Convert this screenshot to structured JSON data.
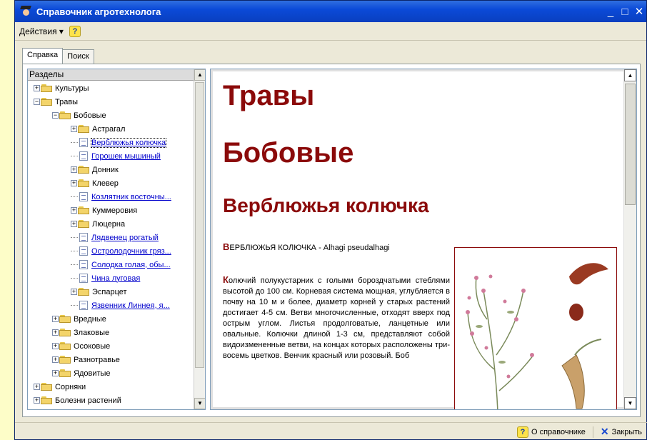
{
  "window": {
    "title": "Справочник агротехнолога",
    "controls": [
      "_",
      "□",
      "✕"
    ]
  },
  "menu": {
    "actions_label": "Действия ▾",
    "help_label": "?"
  },
  "tabs": [
    {
      "label": "Справка"
    },
    {
      "label": "Поиск"
    }
  ],
  "tree": {
    "header": "Разделы",
    "items": [
      {
        "label": "Культуры",
        "kind": "folder",
        "expander": "+",
        "level": 0
      },
      {
        "label": "Травы",
        "kind": "folder",
        "expander": "−",
        "level": 0
      },
      {
        "label": "Бобовые",
        "kind": "folder",
        "expander": "−",
        "level": 1
      },
      {
        "label": "Астрагал",
        "kind": "folder",
        "expander": "+",
        "level": 2
      },
      {
        "label": "Верблюжья колючка",
        "kind": "doc",
        "level": 2,
        "selected": true
      },
      {
        "label": "Горошек мышиный",
        "kind": "doc",
        "level": 2
      },
      {
        "label": "Донник",
        "kind": "folder",
        "expander": "+",
        "level": 2
      },
      {
        "label": "Клевер",
        "kind": "folder",
        "expander": "+",
        "level": 2
      },
      {
        "label": "Козлятник восточны...",
        "kind": "doc",
        "level": 2
      },
      {
        "label": "Куммеровия",
        "kind": "folder",
        "expander": "+",
        "level": 2
      },
      {
        "label": "Люцерна",
        "kind": "folder",
        "expander": "+",
        "level": 2
      },
      {
        "label": "Лядвенец рогатый",
        "kind": "doc",
        "level": 2
      },
      {
        "label": "Остролодочник гряз...",
        "kind": "doc",
        "level": 2
      },
      {
        "label": "Солодка голая, обы...",
        "kind": "doc",
        "level": 2
      },
      {
        "label": "Чина луговая",
        "kind": "doc",
        "level": 2
      },
      {
        "label": "Эспарцет",
        "kind": "folder",
        "expander": "+",
        "level": 2
      },
      {
        "label": "Язвенник Линнея, я...",
        "kind": "doc",
        "level": 2
      },
      {
        "label": "Вредные",
        "kind": "folder",
        "expander": "+",
        "level": 1
      },
      {
        "label": "Злаковые",
        "kind": "folder",
        "expander": "+",
        "level": 1
      },
      {
        "label": "Осоковые",
        "kind": "folder",
        "expander": "+",
        "level": 1
      },
      {
        "label": "Разнотравье",
        "kind": "folder",
        "expander": "+",
        "level": 1
      },
      {
        "label": "Ядовитые",
        "kind": "folder",
        "expander": "+",
        "level": 1
      },
      {
        "label": "Сорняки",
        "kind": "folder",
        "expander": "+",
        "level": 0
      },
      {
        "label": "Болезни растений",
        "kind": "folder",
        "expander": "+",
        "level": 0
      }
    ]
  },
  "article": {
    "h1": "Травы",
    "h2": "Бобовые",
    "h3": "Верблюжья колючка",
    "lead_cap": "В",
    "lead_rest": "ЕРБЛЮЖЬЯ КОЛЮЧКА - Alhagi pseudalhagi",
    "body_cap": "К",
    "body_rest": "олючий полукустарник с голыми бороздчатыми стеблями высотой до 100 см. Корневая система мощная, углубляется в почву на 10 м и более, диаметр корней у старых растений достигает 4-5 см. Ветви многочисленные, отходят вверх под острым углом. Листья продолговатые, ланцетные или овальные. Колючки длиной 1-3 см, представляют собой видоизмененные ветви, на концах которых расположены три-восемь цветков. Венчик красный или розовый. Боб"
  },
  "status": {
    "about_label": "О справочнике",
    "close_label": "Закрыть"
  },
  "colors": {
    "heading": "#8b0a0a",
    "link": "#0000cc",
    "titlebar": "#0b4ad8",
    "page_bg": "#fdfdc8"
  }
}
